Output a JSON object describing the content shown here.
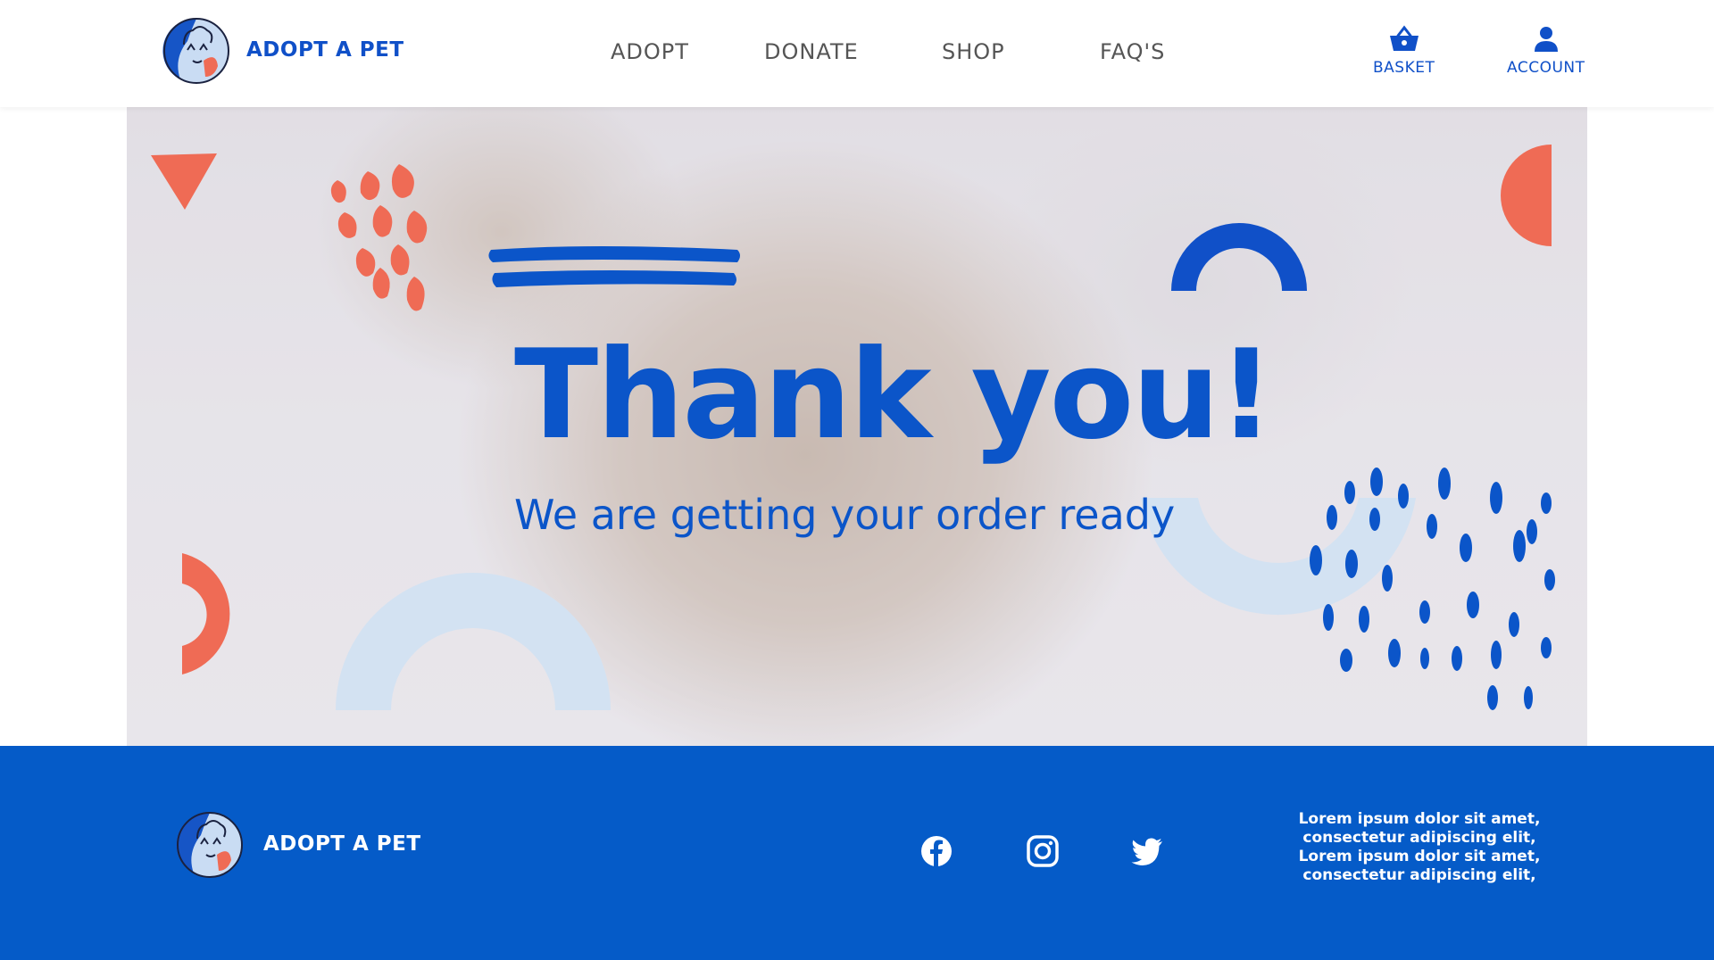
{
  "header": {
    "brand_name": "ADOPT A PET",
    "nav": [
      {
        "label": "ADOPT"
      },
      {
        "label": "DONATE"
      },
      {
        "label": "SHOP"
      },
      {
        "label": "FAQ'S"
      }
    ],
    "actions": {
      "basket": {
        "label": "BASKET",
        "icon": "basket-icon"
      },
      "account": {
        "label": "ACCOUNT",
        "icon": "user-icon"
      }
    }
  },
  "hero": {
    "title": "Thank you!",
    "subtitle": "We are getting your order ready"
  },
  "footer": {
    "brand_name": "ADOPT A PET",
    "social": [
      {
        "icon": "facebook-icon"
      },
      {
        "icon": "instagram-icon"
      },
      {
        "icon": "twitter-icon"
      }
    ],
    "text_lines": [
      "Lorem ipsum dolor sit amet,",
      "consectetur adipiscing elit,",
      "Lorem ipsum dolor sit amet,",
      "consectetur adipiscing elit,"
    ]
  },
  "colors": {
    "primary_blue": "#0b55c9",
    "footer_blue": "#055bc8",
    "coral": "#ef6b55",
    "light_blue": "#d3e2f2",
    "nav_gray": "#555555"
  }
}
